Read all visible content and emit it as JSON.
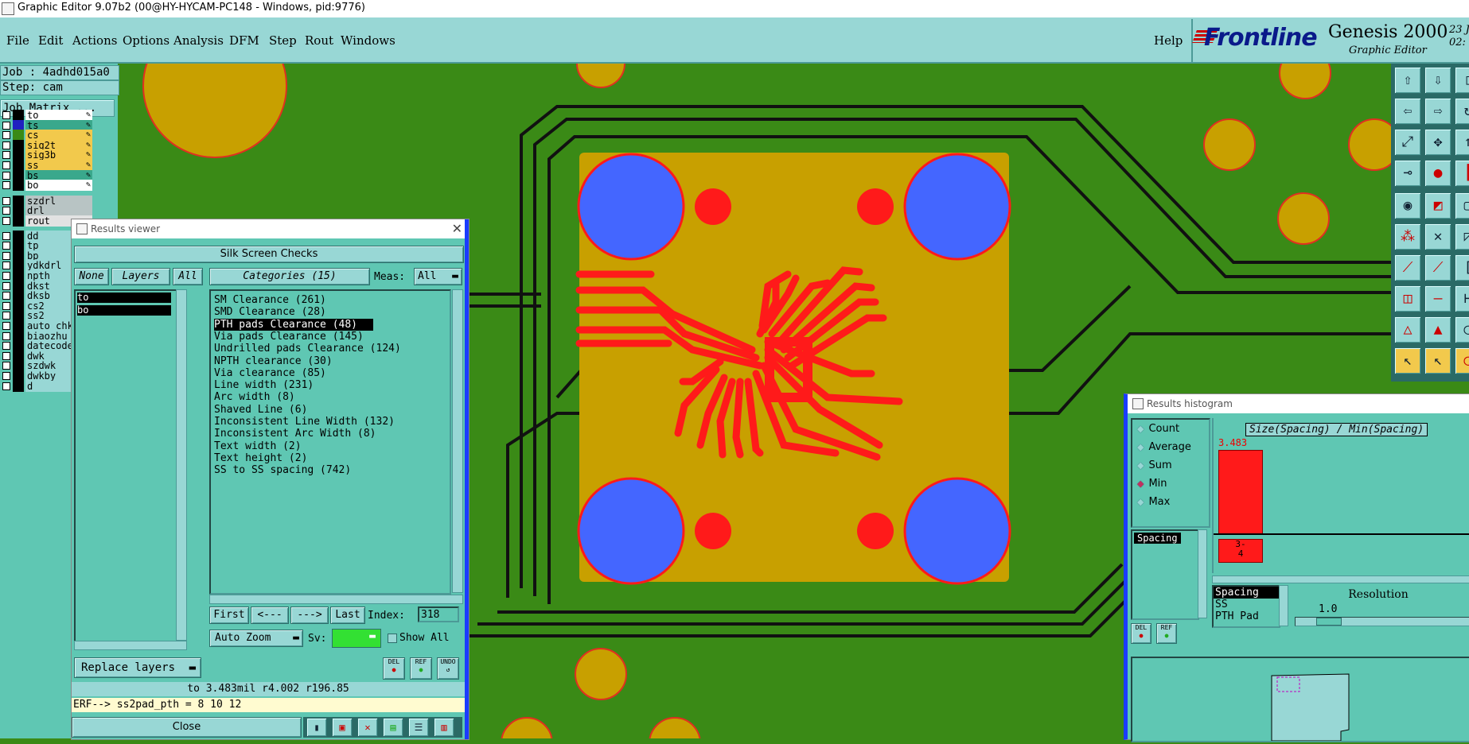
{
  "window_title": "Graphic Editor 9.07b2 (00@HY-HYCAM-PC148 - Windows, pid:9776)",
  "menu": [
    "File",
    "Edit",
    "Actions",
    "Options",
    "Analysis",
    "DFM",
    "Step",
    "Rout",
    "Windows"
  ],
  "help_label": "Help",
  "brand": {
    "logo": "Frontline",
    "product": "Genesis 2000",
    "subtitle": "Graphic Editor",
    "date_top": "23 J",
    "date_bottom": "02:"
  },
  "job": {
    "job_line": "Job : 4adhd015a0",
    "step_line": "Step: cam",
    "matrix_label": "Job Matrix ..."
  },
  "layers": [
    {
      "name": "to",
      "bg": "#ffffff",
      "sw": "#000000",
      "edit": true
    },
    {
      "name": "ts",
      "bg": "#3aa88c",
      "sw": "#2020c0",
      "edit": true
    },
    {
      "name": "cs",
      "bg": "#f2c94c",
      "sw": "#3a8a16",
      "edit": true
    },
    {
      "name": "sig2t",
      "bg": "#f2c94c",
      "sw": "#000000",
      "edit": true
    },
    {
      "name": "sig3b",
      "bg": "#f2c94c",
      "sw": "#000000",
      "edit": true
    },
    {
      "name": "ss",
      "bg": "#f2c94c",
      "sw": "#000000",
      "edit": true
    },
    {
      "name": "bs",
      "bg": "#3aa88c",
      "sw": "#000000",
      "edit": true
    },
    {
      "name": "bo",
      "bg": "#ffffff",
      "sw": "#000000",
      "edit": true
    },
    {
      "name": "szdrl",
      "bg": "#b8c4c4",
      "sw": "#000000",
      "edit": false
    },
    {
      "name": "drl",
      "bg": "#b8c4c4",
      "sw": "#000000",
      "edit": false
    },
    {
      "name": "rout",
      "bg": "#e2e2e2",
      "sw": "#000000",
      "edit": false
    },
    {
      "name": "dd",
      "bg": "#98d7d5",
      "sw": "#000000",
      "edit": false
    },
    {
      "name": "tp",
      "bg": "#98d7d5",
      "sw": "#000000",
      "edit": false
    },
    {
      "name": "bp",
      "bg": "#98d7d5",
      "sw": "#000000",
      "edit": false
    },
    {
      "name": "ydkdrl",
      "bg": "#98d7d5",
      "sw": "#000000",
      "edit": false
    },
    {
      "name": "npth",
      "bg": "#98d7d5",
      "sw": "#000000",
      "edit": false
    },
    {
      "name": "dkst",
      "bg": "#98d7d5",
      "sw": "#000000",
      "edit": false
    },
    {
      "name": "dksb",
      "bg": "#98d7d5",
      "sw": "#000000",
      "edit": false
    },
    {
      "name": "cs2",
      "bg": "#98d7d5",
      "sw": "#000000",
      "edit": false
    },
    {
      "name": "ss2",
      "bg": "#98d7d5",
      "sw": "#000000",
      "edit": false
    },
    {
      "name": "auto_chk",
      "bg": "#98d7d5",
      "sw": "#000000",
      "edit": false
    },
    {
      "name": "biaozhu",
      "bg": "#98d7d5",
      "sw": "#000000",
      "edit": false
    },
    {
      "name": "datecode",
      "bg": "#98d7d5",
      "sw": "#000000",
      "edit": false
    },
    {
      "name": "dwk",
      "bg": "#98d7d5",
      "sw": "#000000",
      "edit": false
    },
    {
      "name": "szdwk",
      "bg": "#98d7d5",
      "sw": "#000000",
      "edit": false
    },
    {
      "name": "dwkby",
      "bg": "#98d7d5",
      "sw": "#000000",
      "edit": false
    },
    {
      "name": "d",
      "bg": "#98d7d5",
      "sw": "#000000",
      "edit": false
    }
  ],
  "results_viewer": {
    "title": "Results viewer",
    "header": "Silk Screen Checks",
    "none_label": "None",
    "layers_label": "Layers",
    "all_label": "All",
    "categories_label": "Categories (15)",
    "meas_label": "Meas:",
    "meas_value": "All",
    "layer_items": [
      "to",
      "bo"
    ],
    "categories": [
      "SM Clearance (261)",
      "SMD Clearance (28)",
      "PTH pads Clearance (48)",
      "Via pads Clearance (145)",
      "Undrilled pads Clearance (124)",
      "NPTH clearance (30)",
      "Via clearance (85)",
      "Line width (231)",
      "Arc width (8)",
      "Shaved Line (6)",
      "Inconsistent Line Width (132)",
      "Inconsistent Arc Width (8)",
      "Text width (2)",
      "Text height (2)",
      "SS to SS spacing (742)"
    ],
    "selected_index": 2,
    "first_label": "First",
    "prev_label": "<---",
    "next_label": "--->",
    "last_label": "Last",
    "index_label": "Index:",
    "index_value": "318",
    "autozoom_label": "Auto Zoom",
    "sv_label": "Sv:",
    "showall_label": "Show All",
    "replace_label": "Replace layers",
    "del_label": "DEL",
    "ref_label": "REF",
    "undo_label": "UNDO",
    "measurement": "to 3.483mil  r4.002  r196.85",
    "erf": "ERF--> ss2pad_pth = 8 10 12",
    "close_label": "Close"
  },
  "histogram": {
    "title": "Results histogram",
    "modes": [
      "Count",
      "Average",
      "Sum",
      "Min",
      "Max"
    ],
    "selected_mode": "Min",
    "spacing_label": "Spacing",
    "header": "Size(Spacing) / Min(Spacing)",
    "bar_value": "3.483",
    "bar_fraction": 1.0,
    "bin_label": "3-\n4",
    "del_label": "DEL",
    "ref_label": "REF",
    "measures": [
      "Spacing",
      "SS",
      "PTH Pad"
    ],
    "resolution_label": "Resolution",
    "resolution_value": "1.0"
  },
  "colors": {
    "board_green": "#3a8a16",
    "gold": "#c8a000",
    "pad_blue": "#4466ff",
    "copper_red": "#ff1a1a",
    "panel_teal": "#5fc7b3",
    "menu_teal": "#98d7d5"
  }
}
